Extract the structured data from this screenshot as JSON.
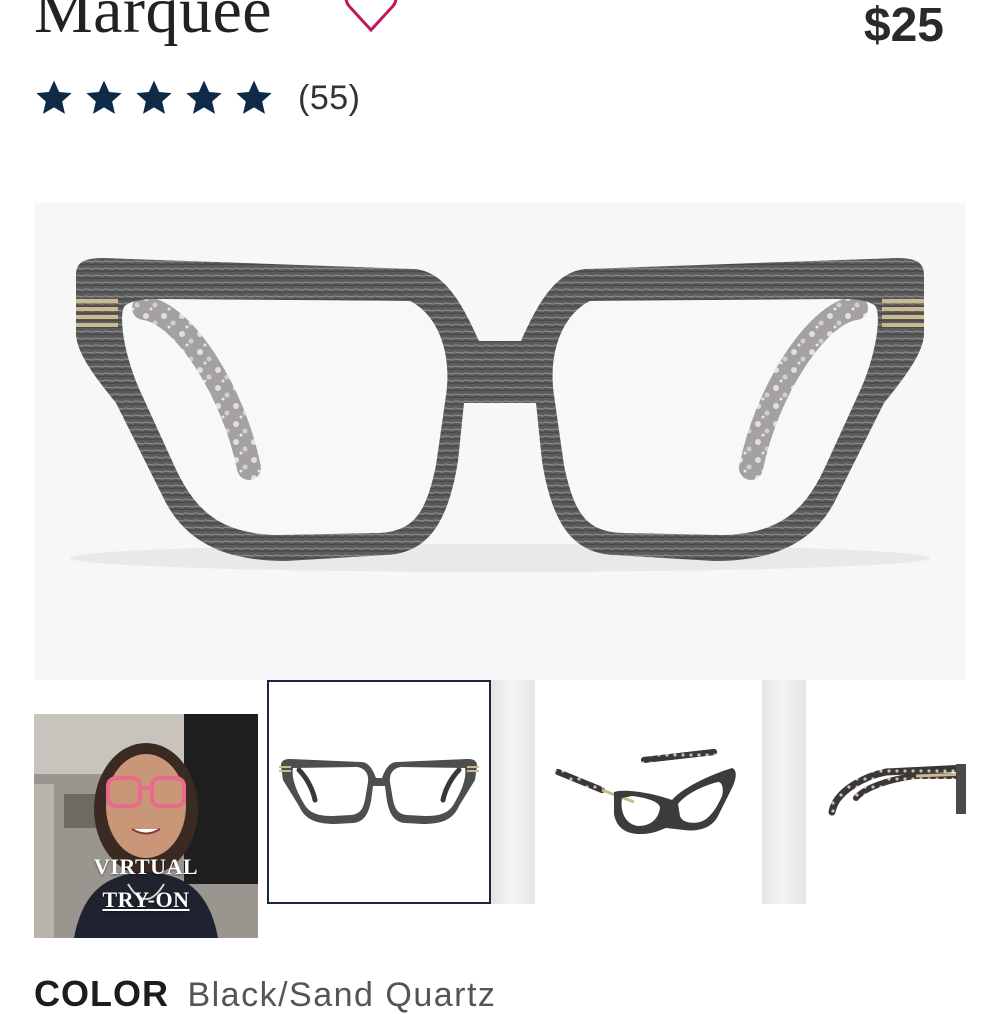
{
  "product": {
    "name": "Marquee",
    "price": "$25",
    "rating": 5,
    "rating_max": 5,
    "review_count": "(55)"
  },
  "gallery": {
    "try_on": {
      "line1": "VIRTUAL",
      "line2": "TRY-ON"
    }
  },
  "color": {
    "label": "COLOR",
    "value": "Black/Sand Quartz"
  },
  "colors": {
    "star": "#0e2a47",
    "favorite": "#c2185b",
    "selected_border": "#1a2744"
  },
  "icons": [
    "heart-outline-icon",
    "star-icon"
  ]
}
